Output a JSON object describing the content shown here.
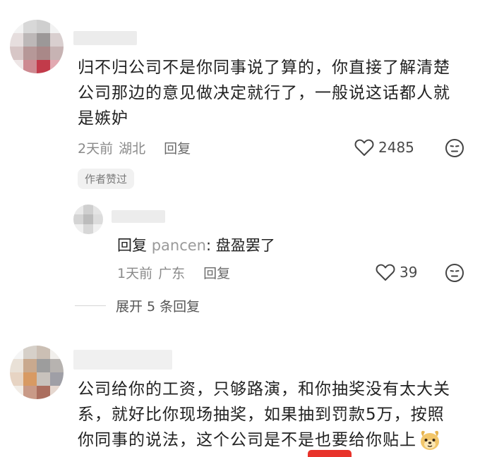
{
  "comments": [
    {
      "text_lines": [
        "归不归公司不是你同事说了算的，你直接了解清楚",
        "公司那边的意见做决定就行了，一般说这话都人就",
        "是嫉妒"
      ],
      "time": "2天前",
      "location": "湖北",
      "reply_label": "回复",
      "likes": "2485",
      "badge": "作者赞过",
      "replies": [
        {
          "prefix": "回复",
          "mention": "pancen",
          "text": ": 盘盈罢了",
          "time": "1天前",
          "location": "广东",
          "reply_label": "回复",
          "likes": "39"
        }
      ],
      "expand_label": "展开 5 条回复"
    },
    {
      "text_lines": [
        "公司给你的工资，只够路演，和你抽奖没有太大关",
        "系，就好比你现场抽奖，如果抽到罚款5万，按照",
        "你同事的说法，这个公司是不是也要给你贴上"
      ]
    }
  ],
  "icons": {
    "like": "heart-outline-icon",
    "dislike": "emoji-face-icon",
    "sticker": "dog-face-sticker-icon"
  },
  "colors": {
    "accent_red": "#e8332b",
    "muted": "#8a8a8a"
  }
}
